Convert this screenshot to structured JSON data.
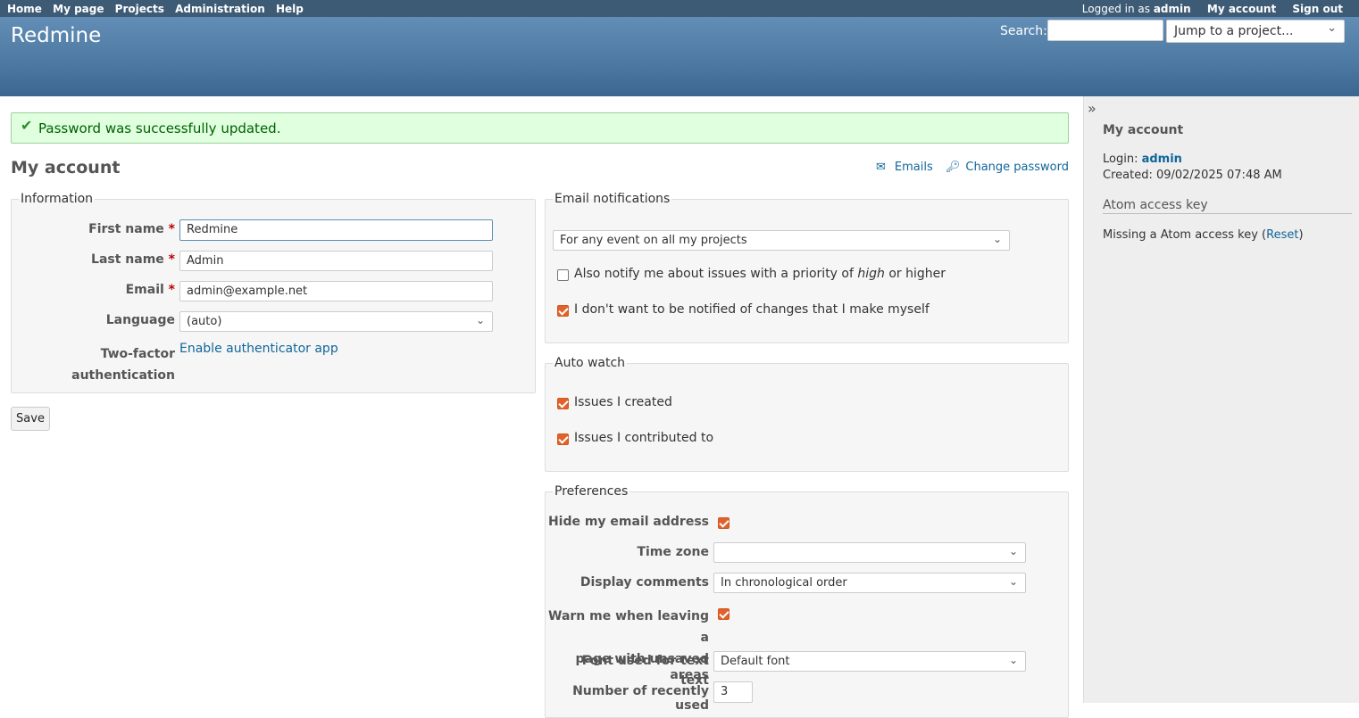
{
  "top_menu": {
    "left": [
      "Home",
      "My page",
      "Projects",
      "Administration",
      "Help"
    ],
    "logged_prefix": "Logged in as",
    "logged_user": "admin",
    "my_account": "My account",
    "sign_out": "Sign out"
  },
  "header": {
    "title": "Redmine",
    "search_label": "Search:",
    "search_value": "",
    "jump_placeholder": "Jump to a project..."
  },
  "flash": {
    "message": "Password was successfully updated."
  },
  "page": {
    "title": "My account",
    "emails_link": "Emails",
    "change_password_link": "Change password"
  },
  "information": {
    "legend": "Information",
    "first_name_label": "First name",
    "first_name_value": "Redmine",
    "last_name_label": "Last name",
    "last_name_value": "Admin",
    "email_label": "Email",
    "email_value": "admin@example.net",
    "language_label": "Language",
    "language_value": "(auto)",
    "twofa_label_1": "Two-factor",
    "twofa_label_2": "authentication",
    "twofa_link": "Enable authenticator app",
    "required_mark": "*"
  },
  "save_label": "Save",
  "email_notifications": {
    "legend": "Email notifications",
    "select_value": "For any event on all my projects",
    "priority_text_prefix": "Also notify me about issues with a priority of ",
    "priority_text_em": "high",
    "priority_text_suffix": " or higher",
    "priority_checked": false,
    "no_self_text": "I don't want to be notified of changes that I make myself",
    "no_self_checked": true
  },
  "auto_watch": {
    "legend": "Auto watch",
    "created_text": "Issues I created",
    "created_checked": true,
    "contributed_text": "Issues I contributed to",
    "contributed_checked": true
  },
  "preferences": {
    "legend": "Preferences",
    "hide_email_label": "Hide my email address",
    "time_zone_label": "Time zone",
    "time_zone_value": "",
    "display_comments_label": "Display comments",
    "display_comments_value": "In chronological order",
    "warn_label_1": "Warn me when leaving a",
    "warn_label_2": "page with unsaved text",
    "font_label": "Font used for text areas",
    "font_value": "Default font",
    "recent_label": "Number of recently used",
    "recent_value": "3"
  },
  "sidebar": {
    "title": "My account",
    "login_label": "Login:",
    "login_value": "admin",
    "created": "Created: 09/02/2025 07:48 AM",
    "atom_heading": "Atom access key",
    "atom_text": "Missing a Atom access key (",
    "atom_reset": "Reset",
    "atom_close": ")"
  },
  "colors": {
    "top_menu": "#3E5B76",
    "header": "#628DB6",
    "flash_bg": "#DFFFDF",
    "checkbox": "#E0622A",
    "link": "#169"
  }
}
